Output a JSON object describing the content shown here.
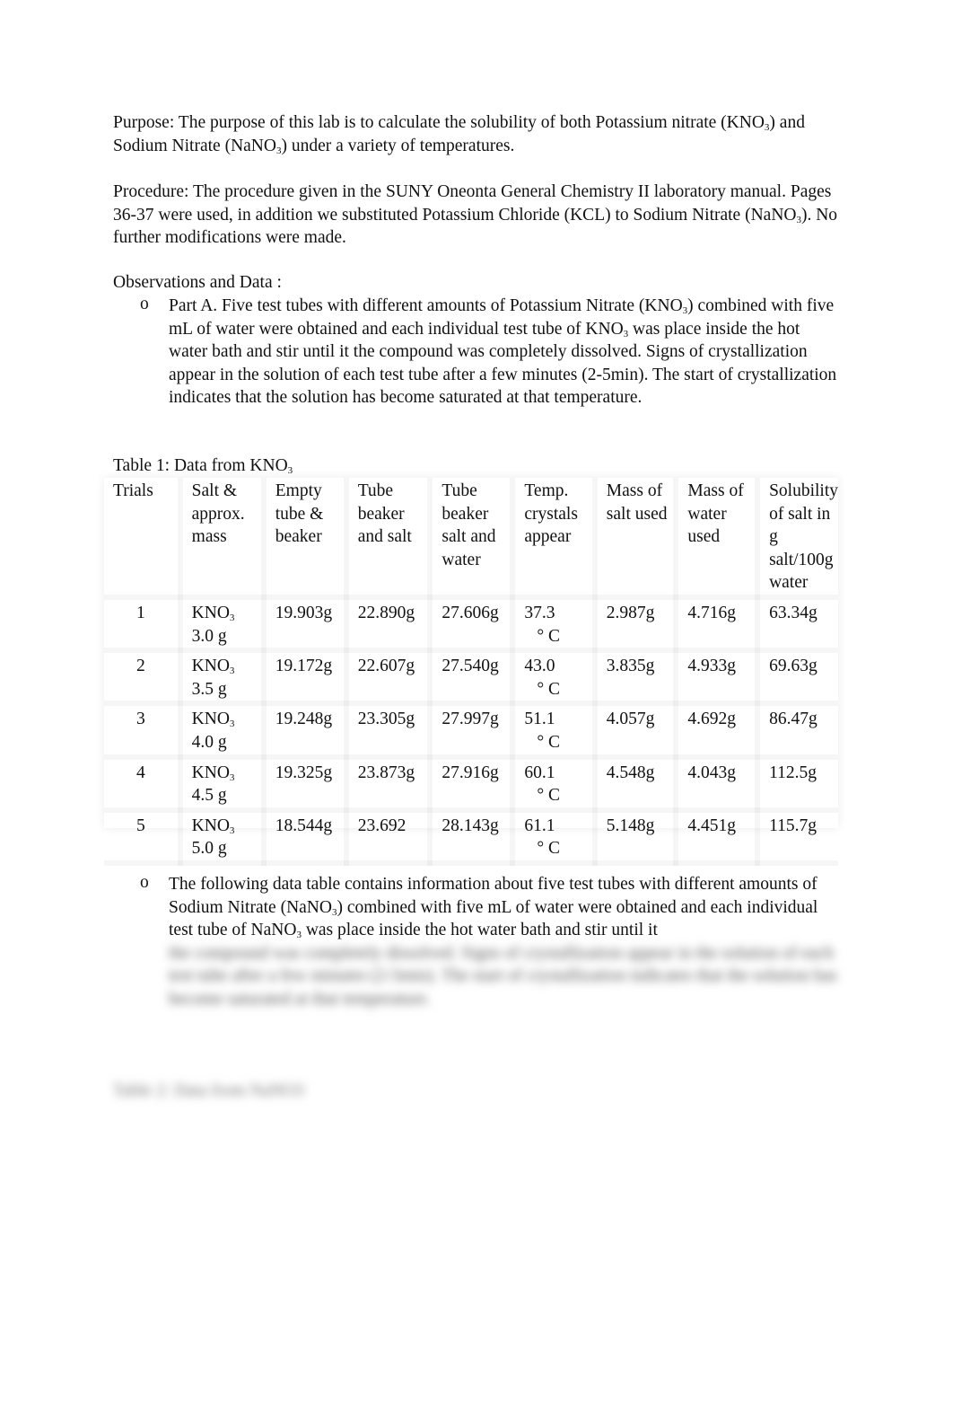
{
  "purpose": {
    "label": "Purpose",
    "text_before": ": The purpose of this lab is to calculate the solubility of both Potassium nitrate (KNO",
    "text_mid": ") and Sodium Nitrate (NaNO",
    "text_after": ") under a variety of temperatures.",
    "sub": "3"
  },
  "procedure": {
    "label": "Procedure:",
    "text_before": " The procedure given in the SUNY Oneonta General Chemistry II laboratory manual. Pages 36-37 were used, in addition we substituted Potassium Chloride (KCL) to Sodium Nitrate (NaNO",
    "text_after": "). No further modifications were made.",
    "sub": "3"
  },
  "observations": {
    "heading": "Observations and Data :",
    "bullet_marker": "o",
    "part_a": {
      "t1": " Part A. Five test tubes with different amounts of Potassium Nitrate (KNO",
      "t2": ") combined with five mL of water were obtained and each individual test tube of KNO",
      "t3": " was place inside the hot water bath and stir until it the compound was completely dissolved. Signs of crystallization appear in the solution of each test tube after a few minutes (2-5min). The start of crystallization indicates that the solution has become saturated at that temperature.",
      "sub": "3"
    },
    "part_b": {
      "t1": "The following data table contains information about five test tubes with different amounts of Sodium Nitrate (NaNO",
      "t2": ") combined with five mL of water were obtained and each individual test tube of NaNO",
      "t3": " was place inside the hot water bath and stir until it",
      "blurred": "the compound was completely dissolved. Signs of crystallization appear in the solution of each test tube after a few minutes (2-5min). The start of crystallization indicates that the solution has become saturated at that temperature.",
      "sub": "3"
    }
  },
  "table1": {
    "caption": "Table 1: Data from KNO",
    "caption_sub": "3",
    "headers": [
      "Trials",
      "Salt & approx. mass",
      "Empty tube & beaker",
      "Tube beaker and salt",
      "Tube beaker salt and water",
      "Temp. crystals appear",
      "Mass of salt used",
      "Mass of water used",
      "Solubility of salt in g salt/100g water"
    ],
    "rows": [
      {
        "trial": "1",
        "salt": "KNO",
        "salt_sub": "3",
        "approx": "3.0 g",
        "empty": "19.903g",
        "tube_salt": "22.890g",
        "tube_water": "27.606g",
        "temp": "37.3",
        "temp_unit": "° C",
        "mass_salt": "2.987g",
        "mass_water": "4.716g",
        "solubility": "63.34g"
      },
      {
        "trial": "2",
        "salt": "KNO",
        "salt_sub": "3",
        "approx": "3.5 g",
        "empty": "19.172g",
        "tube_salt": "22.607g",
        "tube_water": "27.540g",
        "temp": "43.0",
        "temp_unit": "° C",
        "mass_salt": "3.835g",
        "mass_water": "4.933g",
        "solubility": "69.63g"
      },
      {
        "trial": "3",
        "salt": "KNO",
        "salt_sub": "3",
        "approx": "4.0 g",
        "empty": "19.248g",
        "tube_salt": "23.305g",
        "tube_water": "27.997g",
        "temp": "51.1",
        "temp_unit": "° C",
        "mass_salt": "4.057g",
        "mass_water": "4.692g",
        "solubility": "86.47g"
      },
      {
        "trial": "4",
        "salt": "KNO",
        "salt_sub": "3",
        "approx": "4.5 g",
        "empty": "19.325g",
        "tube_salt": "23.873g",
        "tube_water": "27.916g",
        "temp": "60.1",
        "temp_unit": "° C",
        "mass_salt": "4.548g",
        "mass_water": "4.043g",
        "solubility": "112.5g"
      },
      {
        "trial": "5",
        "salt": "KNO",
        "salt_sub": "3",
        "approx": "5.0 g",
        "empty": "18.544g",
        "tube_salt": "23.692",
        "tube_water": "28.143g",
        "temp": "61.1",
        "temp_unit": "° C",
        "mass_salt": "5.148g",
        "mass_water": "4.451g",
        "solubility": "115.7g"
      }
    ]
  },
  "table2": {
    "caption": "Table 2: Data from NaNO3"
  }
}
